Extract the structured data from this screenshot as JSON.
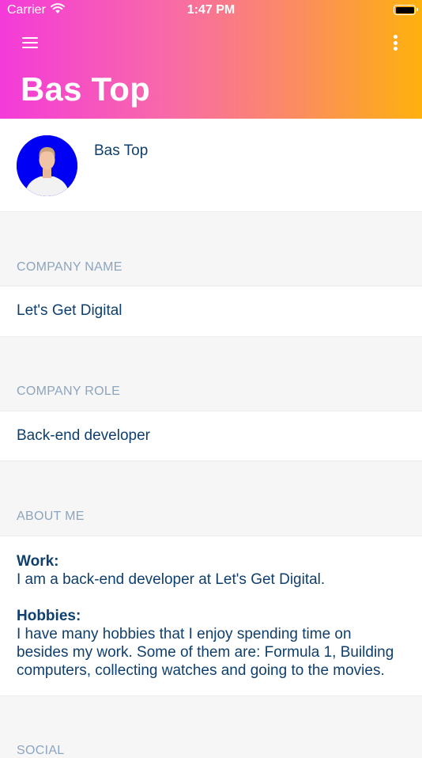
{
  "status_bar": {
    "carrier": "Carrier",
    "time": "1:47 PM"
  },
  "header": {
    "title": "Bas Top"
  },
  "profile": {
    "name": "Bas Top"
  },
  "company_name": {
    "label": "COMPANY NAME",
    "value": "Let's Get Digital"
  },
  "company_role": {
    "label": "COMPANY ROLE",
    "value": "Back-end developer"
  },
  "about_me": {
    "label": "ABOUT ME",
    "work_heading": "Work:",
    "work_text": "I am a back-end developer at Let's Get Digital.",
    "hobbies_heading": "Hobbies:",
    "hobbies_lines": [
      "I have many hobbies that I enjoy spending time on",
      "besides my work. Some of them are: Formula 1, Building",
      "computers, collecting watches and going to the movies."
    ]
  },
  "social": {
    "label": "SOCIAL"
  },
  "colors": {
    "gradient_start": "#f43ad9",
    "gradient_end": "#feb10d",
    "text": "#0f3f6e",
    "label": "#8da4be",
    "background": "#f6f6f6"
  }
}
